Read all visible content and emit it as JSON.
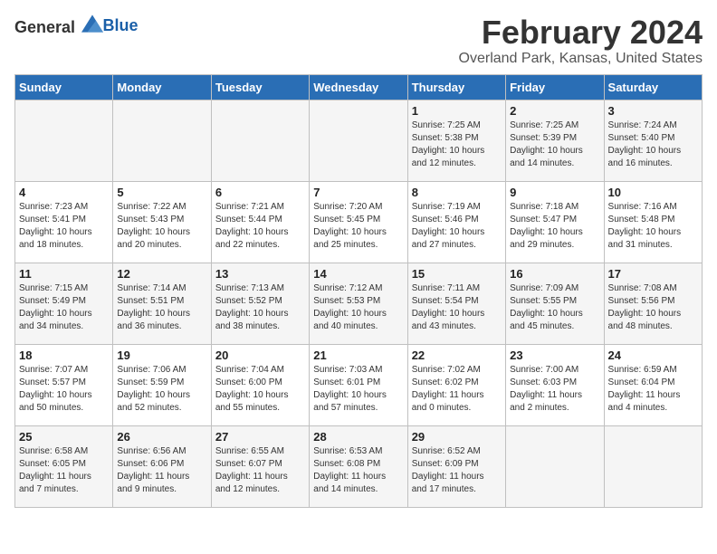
{
  "logo": {
    "general": "General",
    "blue": "Blue"
  },
  "title": "February 2024",
  "location": "Overland Park, Kansas, United States",
  "days_of_week": [
    "Sunday",
    "Monday",
    "Tuesday",
    "Wednesday",
    "Thursday",
    "Friday",
    "Saturday"
  ],
  "weeks": [
    [
      {
        "day": "",
        "info": ""
      },
      {
        "day": "",
        "info": ""
      },
      {
        "day": "",
        "info": ""
      },
      {
        "day": "",
        "info": ""
      },
      {
        "day": "1",
        "info": "Sunrise: 7:25 AM\nSunset: 5:38 PM\nDaylight: 10 hours\nand 12 minutes."
      },
      {
        "day": "2",
        "info": "Sunrise: 7:25 AM\nSunset: 5:39 PM\nDaylight: 10 hours\nand 14 minutes."
      },
      {
        "day": "3",
        "info": "Sunrise: 7:24 AM\nSunset: 5:40 PM\nDaylight: 10 hours\nand 16 minutes."
      }
    ],
    [
      {
        "day": "4",
        "info": "Sunrise: 7:23 AM\nSunset: 5:41 PM\nDaylight: 10 hours\nand 18 minutes."
      },
      {
        "day": "5",
        "info": "Sunrise: 7:22 AM\nSunset: 5:43 PM\nDaylight: 10 hours\nand 20 minutes."
      },
      {
        "day": "6",
        "info": "Sunrise: 7:21 AM\nSunset: 5:44 PM\nDaylight: 10 hours\nand 22 minutes."
      },
      {
        "day": "7",
        "info": "Sunrise: 7:20 AM\nSunset: 5:45 PM\nDaylight: 10 hours\nand 25 minutes."
      },
      {
        "day": "8",
        "info": "Sunrise: 7:19 AM\nSunset: 5:46 PM\nDaylight: 10 hours\nand 27 minutes."
      },
      {
        "day": "9",
        "info": "Sunrise: 7:18 AM\nSunset: 5:47 PM\nDaylight: 10 hours\nand 29 minutes."
      },
      {
        "day": "10",
        "info": "Sunrise: 7:16 AM\nSunset: 5:48 PM\nDaylight: 10 hours\nand 31 minutes."
      }
    ],
    [
      {
        "day": "11",
        "info": "Sunrise: 7:15 AM\nSunset: 5:49 PM\nDaylight: 10 hours\nand 34 minutes."
      },
      {
        "day": "12",
        "info": "Sunrise: 7:14 AM\nSunset: 5:51 PM\nDaylight: 10 hours\nand 36 minutes."
      },
      {
        "day": "13",
        "info": "Sunrise: 7:13 AM\nSunset: 5:52 PM\nDaylight: 10 hours\nand 38 minutes."
      },
      {
        "day": "14",
        "info": "Sunrise: 7:12 AM\nSunset: 5:53 PM\nDaylight: 10 hours\nand 40 minutes."
      },
      {
        "day": "15",
        "info": "Sunrise: 7:11 AM\nSunset: 5:54 PM\nDaylight: 10 hours\nand 43 minutes."
      },
      {
        "day": "16",
        "info": "Sunrise: 7:09 AM\nSunset: 5:55 PM\nDaylight: 10 hours\nand 45 minutes."
      },
      {
        "day": "17",
        "info": "Sunrise: 7:08 AM\nSunset: 5:56 PM\nDaylight: 10 hours\nand 48 minutes."
      }
    ],
    [
      {
        "day": "18",
        "info": "Sunrise: 7:07 AM\nSunset: 5:57 PM\nDaylight: 10 hours\nand 50 minutes."
      },
      {
        "day": "19",
        "info": "Sunrise: 7:06 AM\nSunset: 5:59 PM\nDaylight: 10 hours\nand 52 minutes."
      },
      {
        "day": "20",
        "info": "Sunrise: 7:04 AM\nSunset: 6:00 PM\nDaylight: 10 hours\nand 55 minutes."
      },
      {
        "day": "21",
        "info": "Sunrise: 7:03 AM\nSunset: 6:01 PM\nDaylight: 10 hours\nand 57 minutes."
      },
      {
        "day": "22",
        "info": "Sunrise: 7:02 AM\nSunset: 6:02 PM\nDaylight: 11 hours\nand 0 minutes."
      },
      {
        "day": "23",
        "info": "Sunrise: 7:00 AM\nSunset: 6:03 PM\nDaylight: 11 hours\nand 2 minutes."
      },
      {
        "day": "24",
        "info": "Sunrise: 6:59 AM\nSunset: 6:04 PM\nDaylight: 11 hours\nand 4 minutes."
      }
    ],
    [
      {
        "day": "25",
        "info": "Sunrise: 6:58 AM\nSunset: 6:05 PM\nDaylight: 11 hours\nand 7 minutes."
      },
      {
        "day": "26",
        "info": "Sunrise: 6:56 AM\nSunset: 6:06 PM\nDaylight: 11 hours\nand 9 minutes."
      },
      {
        "day": "27",
        "info": "Sunrise: 6:55 AM\nSunset: 6:07 PM\nDaylight: 11 hours\nand 12 minutes."
      },
      {
        "day": "28",
        "info": "Sunrise: 6:53 AM\nSunset: 6:08 PM\nDaylight: 11 hours\nand 14 minutes."
      },
      {
        "day": "29",
        "info": "Sunrise: 6:52 AM\nSunset: 6:09 PM\nDaylight: 11 hours\nand 17 minutes."
      },
      {
        "day": "",
        "info": ""
      },
      {
        "day": "",
        "info": ""
      }
    ]
  ]
}
